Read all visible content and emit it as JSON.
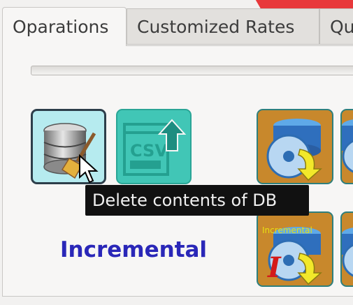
{
  "tabs": [
    {
      "label": "Oparations",
      "active": true
    },
    {
      "label": "Customized Rates",
      "active": false
    },
    {
      "label": "Qu",
      "active": false
    }
  ],
  "operations": {
    "delete_db_icon": "database-broom-icon",
    "csv_export_icon": "csv-export-icon",
    "incremental_label": "Incremental",
    "incremental_icon_text": "Incremental",
    "tooltip": "Delete contents of DB"
  },
  "colors": {
    "incremental_label": "#2a27b8",
    "csv_button": "#41c6b6",
    "db_button": "#b6ebef",
    "backup_button": "#c8882c"
  }
}
